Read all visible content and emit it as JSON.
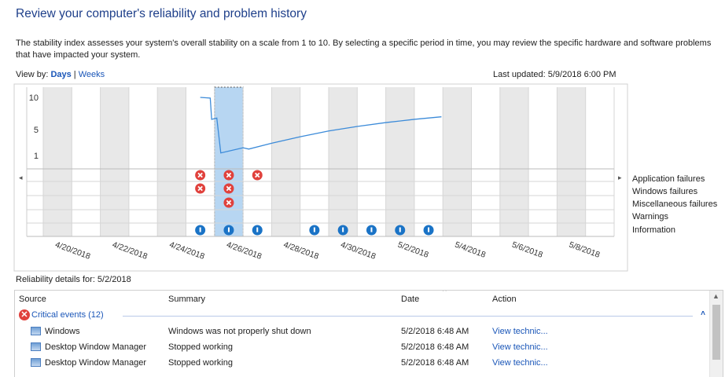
{
  "page": {
    "title": "Review your computer's reliability and problem history",
    "description": "The stability index assesses your system's overall stability on a scale from 1 to 10. By selecting a specific period in time, you may review the specific hardware and software problems that have impacted your system.",
    "view_by_label": "View by:",
    "view_days": "Days",
    "view_sep": "|",
    "view_weeks": "Weeks",
    "last_updated": "Last updated: 5/9/2018 6:00 PM"
  },
  "chart": {
    "y_ticks": [
      "10",
      "5",
      "1"
    ],
    "date_labels": [
      "4/20/2018",
      "4/22/2018",
      "4/24/2018",
      "4/26/2018",
      "4/28/2018",
      "4/30/2018",
      "5/2/2018",
      "5/4/2018",
      "5/6/2018",
      "5/8/2018"
    ],
    "selected_day": 6,
    "row_labels": [
      "Application failures",
      "Windows failures",
      "Miscellaneous failures",
      "Warnings",
      "Information"
    ],
    "scroll_left": "◂",
    "scroll_right": "▸",
    "colors": {
      "line": "#3c8bd9",
      "selection": "#b7d6f2",
      "shade": "#e8e8e8",
      "critical": "#e0413c",
      "info": "#1a73c6"
    },
    "stability_index": [
      {
        "day": 5.5,
        "value": 10
      },
      {
        "day": 5.85,
        "value": 9.9
      },
      {
        "day": 5.9,
        "value": 6.6
      },
      {
        "day": 6.08,
        "value": 6.8
      },
      {
        "day": 6.22,
        "value": 1.4
      },
      {
        "day": 7.0,
        "value": 2.2
      },
      {
        "day": 7.2,
        "value": 2.0
      },
      {
        "day": 8.0,
        "value": 2.9
      },
      {
        "day": 9.0,
        "value": 3.9
      },
      {
        "day": 10.0,
        "value": 4.8
      },
      {
        "day": 11.0,
        "value": 5.5
      },
      {
        "day": 12.0,
        "value": 6.1
      },
      {
        "day": 13.0,
        "value": 6.6
      },
      {
        "day": 13.95,
        "value": 7.0
      }
    ],
    "events": [
      {
        "day": 5.5,
        "row": 0,
        "kind": "critical"
      },
      {
        "day": 6.5,
        "row": 0,
        "kind": "critical"
      },
      {
        "day": 7.5,
        "row": 0,
        "kind": "critical"
      },
      {
        "day": 5.5,
        "row": 1,
        "kind": "critical"
      },
      {
        "day": 6.5,
        "row": 1,
        "kind": "critical"
      },
      {
        "day": 6.5,
        "row": 2,
        "kind": "critical"
      },
      {
        "day": 5.5,
        "row": 4,
        "kind": "info"
      },
      {
        "day": 6.5,
        "row": 4,
        "kind": "info"
      },
      {
        "day": 7.5,
        "row": 4,
        "kind": "info"
      },
      {
        "day": 9.5,
        "row": 4,
        "kind": "info"
      },
      {
        "day": 10.5,
        "row": 4,
        "kind": "info"
      },
      {
        "day": 11.5,
        "row": 4,
        "kind": "info"
      },
      {
        "day": 12.5,
        "row": 4,
        "kind": "info"
      },
      {
        "day": 13.5,
        "row": 4,
        "kind": "info"
      }
    ]
  },
  "details": {
    "label": "Reliability details for: 5/2/2018",
    "columns": {
      "source": "Source",
      "summary": "Summary",
      "date": "Date",
      "action": "Action"
    },
    "sort_indicator": "^",
    "group_label": "Critical events (12)",
    "group_icon": "✕",
    "collapse": "˄",
    "rows": [
      {
        "source": "Windows",
        "summary": "Windows was not properly shut down",
        "date": "5/2/2018 6:48 AM",
        "action": "View technic..."
      },
      {
        "source": "Desktop Window Manager",
        "summary": "Stopped working",
        "date": "5/2/2018 6:48 AM",
        "action": "View technic..."
      },
      {
        "source": "Desktop Window Manager",
        "summary": "Stopped working",
        "date": "5/2/2018 6:48 AM",
        "action": "View technic..."
      }
    ],
    "scroll_up": "▲"
  }
}
